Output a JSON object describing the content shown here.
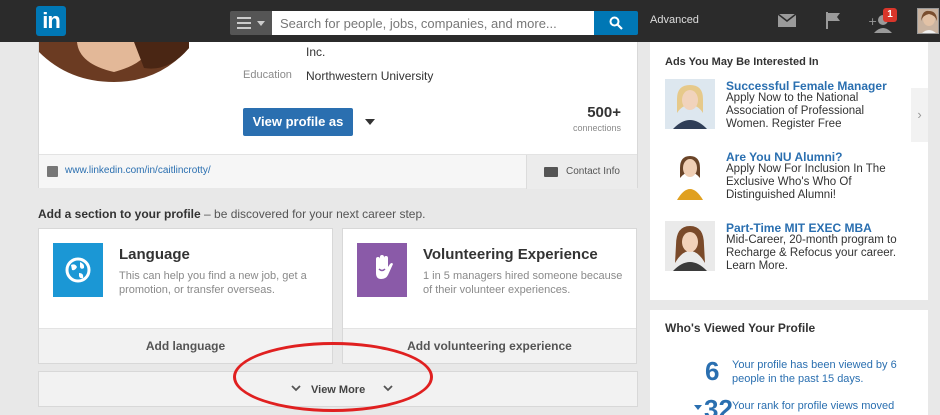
{
  "topbar": {
    "logo_text": "in",
    "search_placeholder": "Search for people, jobs, companies, and more...",
    "advanced_label": "Advanced",
    "notification_count": "1"
  },
  "profile": {
    "company_line": "Inc.",
    "education_label": "Education",
    "education_value": "Northwestern University",
    "view_profile_label": "View profile as",
    "connections_count": "500+",
    "connections_label": "connections",
    "profile_url": "www.linkedin.com/in/caitlincrotty/",
    "contact_info_label": "Contact Info"
  },
  "add_section": {
    "heading_bold": "Add a section to your profile",
    "heading_rest": " – be discovered for your next career step.",
    "cards": [
      {
        "title": "Language",
        "description": "This can help you find a new job, get a promotion, or transfer overseas.",
        "action": "Add language",
        "icon": "globe-icon",
        "color": "#1b97d5"
      },
      {
        "title": "Volunteering Experience",
        "description": "1 in 5 managers hired someone because of their volunteer experiences.",
        "action": "Add volunteering experience",
        "icon": "raised-hand-icon",
        "color": "#8a5aa8"
      }
    ],
    "view_more_label": "View More"
  },
  "ads": {
    "title": "Ads You May Be Interested In",
    "items": [
      {
        "title": "Successful Female Manager",
        "text": "Apply Now to the National Association of Professional Women. Register Free"
      },
      {
        "title": "Are You NU Alumni?",
        "text": "Apply Now For Inclusion In The Exclusive Who's Who Of Distinguished Alumni!"
      },
      {
        "title": "Part-Time MIT EXEC MBA",
        "text": "Mid-Career, 20-month program to Recharge & Refocus your career. Learn More."
      }
    ]
  },
  "who_viewed": {
    "title": "Who's Viewed Your Profile",
    "views_number": "6",
    "views_text": "Your profile has been viewed by 6 people in the past 15 days.",
    "rank_number": "32",
    "rank_text": "Your rank for profile views moved"
  },
  "colors": {
    "linkedin_blue": "#0077b5",
    "link_blue": "#2a6fb0",
    "annotation_red": "#e02020"
  }
}
